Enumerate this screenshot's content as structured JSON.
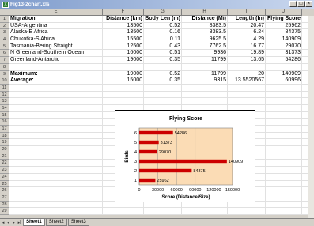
{
  "window": {
    "title": "Fig13-2chart.xls",
    "app_icon": "excel-icon",
    "min": "_",
    "max": "□",
    "close": "×"
  },
  "columns": [
    "E",
    "F",
    "G",
    "H",
    "I",
    "J"
  ],
  "row_numbers": [
    "1",
    "2",
    "3",
    "4",
    "5",
    "6",
    "7",
    "8",
    "9",
    "10",
    "11",
    "12",
    "13",
    "14",
    "15",
    "16",
    "17",
    "18",
    "19",
    "20",
    "21",
    "22",
    "23",
    "24",
    "25",
    "26",
    "27",
    "28",
    "29"
  ],
  "table": {
    "headers": [
      "Migration",
      "Distance (km)",
      "Body Len (m)",
      "Distance (Mi)",
      "Length (In)",
      "Flying Score"
    ],
    "rows": [
      [
        "USA-Argentina",
        "13500",
        "0.52",
        "8383.5",
        "20.47",
        "25962"
      ],
      [
        "Alaska-E Africa",
        "13500",
        "0.16",
        "8383.5",
        "6.24",
        "84375"
      ],
      [
        "Chukotka-S Africa",
        "15500",
        "0.11",
        "9625.5",
        "4.29",
        "140909"
      ],
      [
        "Tasmania-Bering Straight",
        "12500",
        "0.43",
        "7762.5",
        "16.77",
        "29070"
      ],
      [
        "N Greenland-Southern Ocean",
        "16000",
        "0.51",
        "9936",
        "19.89",
        "31373"
      ],
      [
        "Greenland-Antarctic",
        "19000",
        "0.35",
        "11799",
        "13.65",
        "54286"
      ]
    ],
    "max_label": "Maximum:",
    "max_values": [
      "19000",
      "0.52",
      "11799",
      "20",
      "140909"
    ],
    "avg_label": "Average:",
    "avg_values": [
      "15000",
      "0.35",
      "9315",
      "13.5520567",
      "60996"
    ]
  },
  "sheets": [
    "Sheet1",
    "Sheet2",
    "Sheet3"
  ],
  "nav": [
    "|◂",
    "◂",
    "▸",
    "▸|"
  ],
  "colors": {
    "bar": "#cc0000",
    "plot_bg": "#fbdcb5"
  },
  "chart_data": {
    "type": "bar",
    "orientation": "horizontal",
    "title": "Flying Score",
    "xlabel": "Score (Distance/Size)",
    "ylabel": "Birds",
    "categories": [
      "1",
      "2",
      "3",
      "4",
      "5",
      "6"
    ],
    "values": [
      25962,
      84375,
      140909,
      29070,
      31373,
      54286
    ],
    "data_labels": [
      "25962",
      "84375",
      "140909",
      "29070",
      "31373",
      "54286"
    ],
    "xlim": [
      0,
      150000
    ],
    "xticks": [
      "0",
      "30000",
      "60000",
      "90000",
      "120000",
      "150000"
    ],
    "grid": true
  }
}
